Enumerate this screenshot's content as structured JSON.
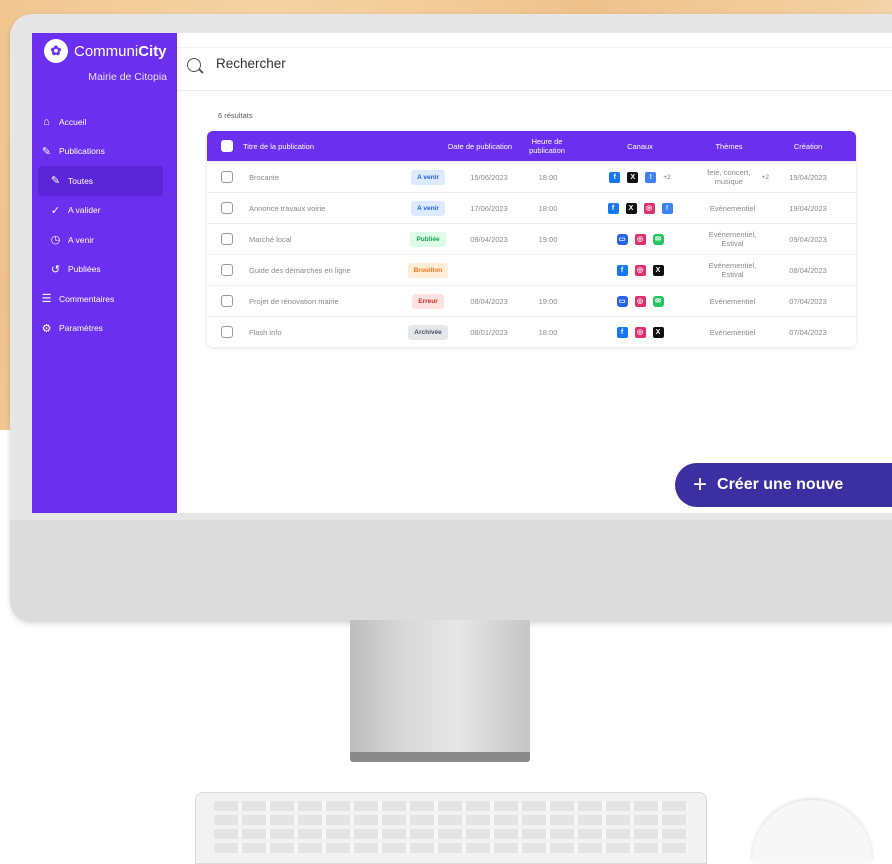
{
  "brand": {
    "name_part1": "Communi",
    "name_part2": "City",
    "organization": "Mairie de Citopia"
  },
  "sidebar": {
    "items": [
      {
        "label": "Accueil",
        "icon": "home-icon"
      },
      {
        "label": "Publications",
        "icon": "edit-icon"
      },
      {
        "label": "Toutes",
        "icon": "edit-icon",
        "active": true
      },
      {
        "label": "A valider",
        "icon": "check-circle-icon"
      },
      {
        "label": "A venir",
        "icon": "clock-icon"
      },
      {
        "label": "Publiées",
        "icon": "history-icon"
      },
      {
        "label": "Commentaires",
        "icon": "comments-icon"
      },
      {
        "label": "Paramètres",
        "icon": "gear-icon"
      }
    ]
  },
  "search": {
    "placeholder": "Rechercher"
  },
  "results": {
    "count_label": "6 résultats"
  },
  "table": {
    "headers": {
      "title": "Titre de la publication",
      "date": "Date de publication",
      "time": "Heure de publication",
      "channels": "Canaux",
      "themes": "Thèmes",
      "created": "Création"
    },
    "rows": [
      {
        "title": "Brocante",
        "status": "A venir",
        "date": "15/06/2023",
        "time": "18:00",
        "channels": [
          "facebook",
          "x",
          "info"
        ],
        "channels_more": "+2",
        "themes": "fete, concert, musique",
        "themes_more": "+2",
        "created": "19/04/2023"
      },
      {
        "title": "Annonce travaux voirie",
        "status": "A venir",
        "date": "17/06/2023",
        "time": "18:00",
        "channels": [
          "facebook",
          "x",
          "instagram",
          "info"
        ],
        "channels_more": "",
        "themes": "Evénementiel",
        "themes_more": "",
        "created": "19/04/2023"
      },
      {
        "title": "Marché local",
        "status": "Publiée",
        "date": "09/04/2023",
        "time": "19:00",
        "channels": [
          "message",
          "instagram",
          "sms"
        ],
        "channels_more": "",
        "themes": "Evénementiel, Estival",
        "themes_more": "",
        "created": "09/04/2023"
      },
      {
        "title": "Guide des démarches en ligne",
        "status": "Brouillon",
        "date": "",
        "time": "",
        "channels": [
          "facebook",
          "instagram",
          "x"
        ],
        "channels_more": "",
        "themes": "Evénementiel, Estival",
        "themes_more": "",
        "created": "08/04/2023"
      },
      {
        "title": "Projet de rénovation mairie",
        "status": "Erreur",
        "date": "08/04/2023",
        "time": "19:00",
        "channels": [
          "message",
          "instagram",
          "sms"
        ],
        "channels_more": "",
        "themes": "Evénementiel",
        "themes_more": "",
        "created": "07/04/2023"
      },
      {
        "title": "Flash info",
        "status": "Archivée",
        "date": "08/01/2023",
        "time": "18:00",
        "channels": [
          "facebook",
          "instagram",
          "x"
        ],
        "channels_more": "",
        "themes": "Evénementiel",
        "themes_more": "",
        "created": "07/04/2023"
      }
    ]
  },
  "status_colors": {
    "A venir": {
      "bg": "#dbeafe",
      "fg": "#2563eb"
    },
    "Publiée": {
      "bg": "#dcfce7",
      "fg": "#16a34a"
    },
    "Brouillon": {
      "bg": "#ffedd5",
      "fg": "#f97316"
    },
    "Erreur": {
      "bg": "#fee2e2",
      "fg": "#dc2626"
    },
    "Archivée": {
      "bg": "#e5e7eb",
      "fg": "#4b5563"
    }
  },
  "cta": {
    "label": "Créer une nouve"
  },
  "colors": {
    "accent": "#6b2ff0",
    "cta": "#3b2fa2"
  }
}
